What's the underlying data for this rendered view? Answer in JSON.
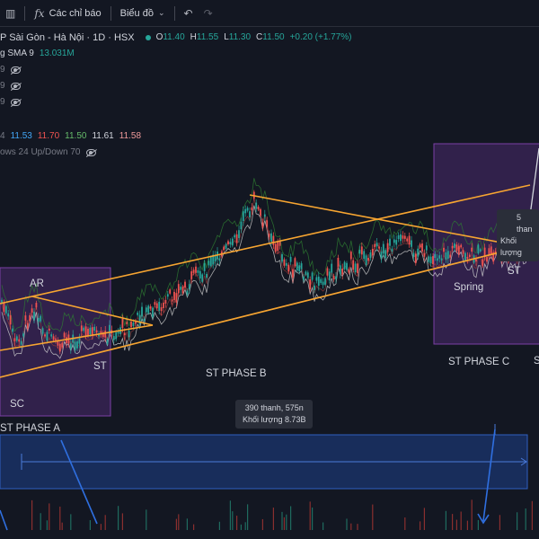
{
  "toolbar": {
    "indicators_label": "Các chỉ báo",
    "templates_label": "Biểu đồ"
  },
  "legend": {
    "symbol_title": "P Sài Gòn - Hà Nội · 1D · HSX",
    "o_label": "O",
    "o_value": "11.40",
    "h_label": "H",
    "h_value": "11.55",
    "l_label": "L",
    "l_value": "11.30",
    "c_label": "C",
    "c_value": "11.50",
    "change": "+0.20 (+1.77%)",
    "sma_label": "g SMA 9",
    "sma_value": "13.031M",
    "row3_prefix": "9",
    "row4_prefix": "9",
    "row5_prefix": "9",
    "ichi_prefix": "4",
    "ichi_values": [
      "11.53",
      "11.70",
      "11.50",
      "11.61",
      "11.58"
    ],
    "ichi_colors": [
      "#42a5f5",
      "#ef5350",
      "#66bb6a",
      "#d1d4dc",
      "#ef9a9a"
    ],
    "rows_label": "ows 24 Up/Down 70"
  },
  "labels": {
    "ar": "AR",
    "st_a": "ST",
    "sc": "SC",
    "phase_a": "ST PHASE A",
    "phase_b": "ST PHASE B",
    "spring": "Spring",
    "st_c": "ST",
    "phase_c": "ST PHASE C",
    "s_right": "S"
  },
  "tooltip_main": {
    "line1": "390 thanh, 575n",
    "line2": "Khối lượng 8.73B"
  },
  "tooltip_right": {
    "line1": "5 than",
    "line2": "Khối lượng"
  },
  "colors": {
    "bg": "#131722",
    "up": "#26a69a",
    "down": "#ef5350",
    "trend": "#f7a531",
    "phase_box": "#7b3fa5",
    "range_box": "#1e3f8a",
    "arrow": "#2f6fe0"
  }
}
